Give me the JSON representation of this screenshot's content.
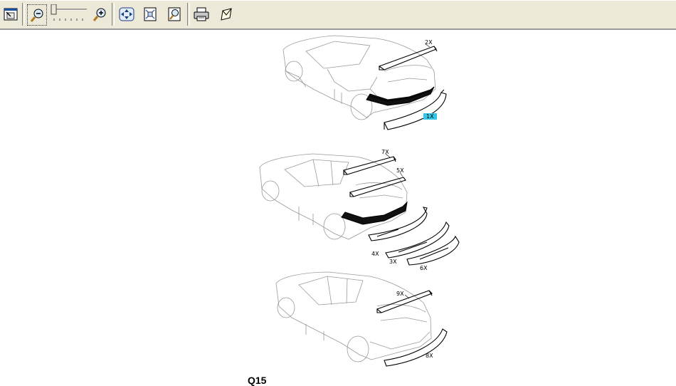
{
  "toolbar": {
    "buttons": [
      {
        "name": "fit-window",
        "icon": "restore-window-icon"
      },
      {
        "name": "zoom-out",
        "icon": "zoom-out-icon"
      },
      {
        "name": "zoom-in",
        "icon": "zoom-in-icon"
      },
      {
        "name": "pan",
        "icon": "pan-arrows-icon"
      },
      {
        "name": "fit-page",
        "icon": "fit-page-icon"
      },
      {
        "name": "zoom-area",
        "icon": "zoom-area-icon"
      },
      {
        "name": "print",
        "icon": "printer-icon"
      },
      {
        "name": "send",
        "icon": "send-icon"
      }
    ]
  },
  "diagram": {
    "callouts": {
      "c2x": "2X",
      "c1x": "1X",
      "c7x": "7X",
      "c5x": "5X",
      "c4x": "4X",
      "c3x": "3X",
      "c6x": "6X",
      "c9x": "9X",
      "c8x": "8X"
    },
    "highlight_color": "#33c6e8",
    "figure_code": "Q15"
  }
}
